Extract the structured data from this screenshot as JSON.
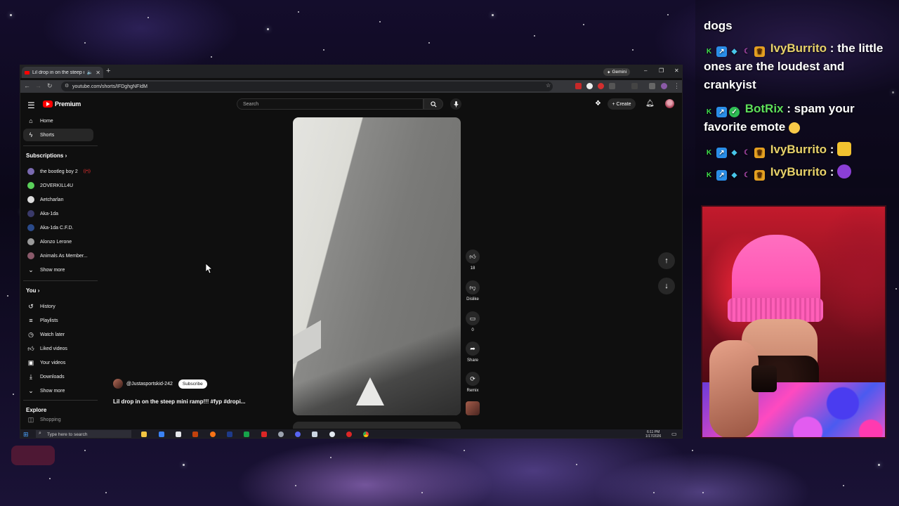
{
  "browser": {
    "tab_title": "Lil drop in on the steep mi",
    "new_tab": "+",
    "gemini_label": "Gemini",
    "url": "youtube.com/shorts/IFDghgNFIdM"
  },
  "youtube": {
    "logo_text": "Premium",
    "search_placeholder": "Search",
    "create_label": "Create",
    "nav": [
      {
        "label": "Home",
        "icon": "home-icon"
      },
      {
        "label": "Shorts",
        "icon": "shorts-icon"
      }
    ],
    "subscriptions_title": "Subscriptions",
    "subscriptions": [
      {
        "label": "the bootleg boy 2",
        "color": "#7a6ab0"
      },
      {
        "label": "2OVERKILL4U",
        "color": "#5ad05a"
      },
      {
        "label": "Aetcharlan",
        "color": "#dddddd"
      },
      {
        "label": "Aka-1da",
        "color": "#3a3a6a"
      },
      {
        "label": "Aka-1da C.F.D.",
        "color": "#2a4a8a"
      },
      {
        "label": "Alonzo Lerone",
        "color": "#9a9a9a"
      },
      {
        "label": "Animals As Member...",
        "color": "#8a5a6a"
      }
    ],
    "show_more": "Show more",
    "you_title": "You",
    "you_items": [
      {
        "label": "History",
        "icon": "history-icon"
      },
      {
        "label": "Playlists",
        "icon": "playlists-icon"
      },
      {
        "label": "Watch later",
        "icon": "watch-later-icon"
      },
      {
        "label": "Liked videos",
        "icon": "like-icon"
      },
      {
        "label": "Your videos",
        "icon": "your-videos-icon"
      },
      {
        "label": "Downloads",
        "icon": "download-icon"
      },
      {
        "label": "Show more",
        "icon": "chevron-down-icon"
      }
    ],
    "explore_title": "Explore",
    "explore_peek": "Shopping",
    "actions": {
      "like_count": "18",
      "dislike_label": "Dislike",
      "comment_count": "0",
      "share_label": "Share",
      "remix_label": "Remix"
    },
    "channel_name": "@Justasportskid-242",
    "subscribe_label": "Subscribe",
    "video_title": "Lil drop in on the steep mini ramp!!! #fyp #dropi..."
  },
  "taskbar": {
    "search_placeholder": "Type here to search",
    "time": "6:11 PM",
    "date": "1/17/2026"
  },
  "chat": [
    {
      "user": "",
      "message": "dogs"
    },
    {
      "user": "IvyBurrito",
      "message": ": the little ones are the loudest and crankyist"
    },
    {
      "user": "BotRix",
      "message": ": spam your favorite emote"
    },
    {
      "user": "IvyBurrito",
      "message": ":"
    },
    {
      "user": "IvyBurrito",
      "message": ":"
    }
  ],
  "colors": {
    "youtube_red": "#ff0000",
    "chat_user_yellow": "#e8d26a",
    "chat_user_green": "#5ee05a",
    "beanie_pink": "#ff5fb8"
  }
}
